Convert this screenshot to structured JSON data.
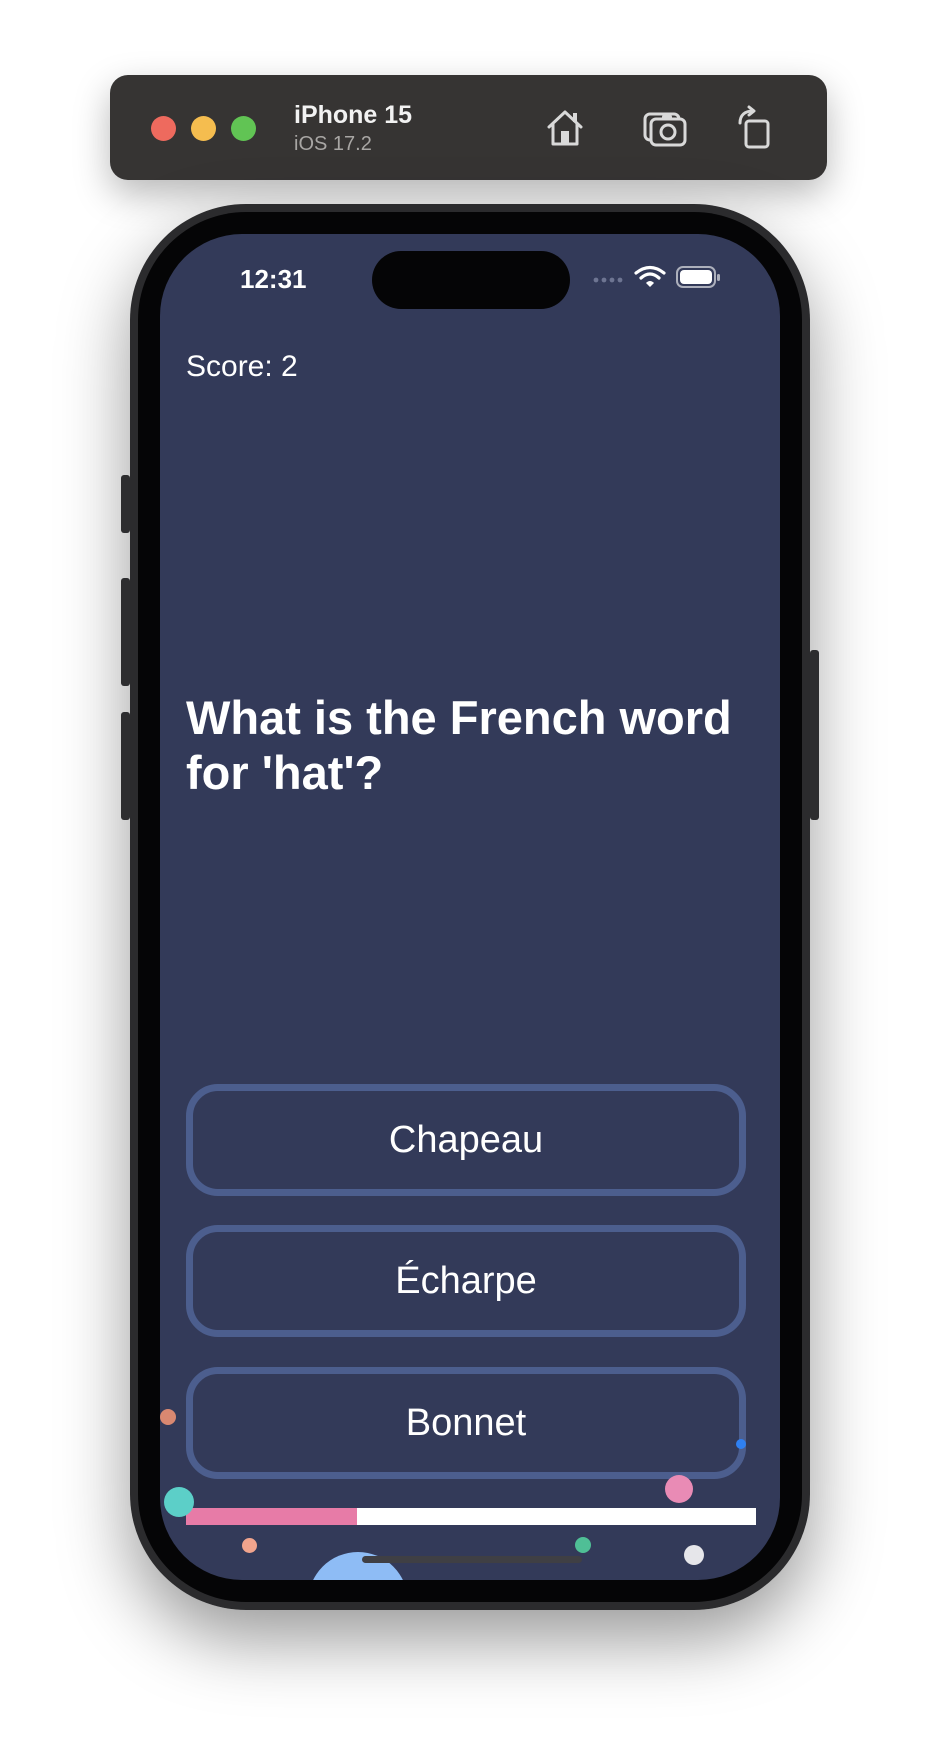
{
  "simulator": {
    "device_name": "iPhone 15",
    "os_version": "iOS 17.2",
    "toolbar_icons": [
      "home-icon",
      "screenshot-icon",
      "rotate-icon"
    ]
  },
  "status_bar": {
    "time": "12:31",
    "icons": [
      "signal-icon",
      "wifi-icon",
      "battery-icon"
    ]
  },
  "quiz": {
    "score_label": "Score: 2",
    "question": "What is the French word for 'hat'?",
    "answers": [
      "Chapeau",
      "Écharpe",
      "Bonnet"
    ],
    "progress": 0.3
  },
  "colors": {
    "background": "#333a59",
    "answer_border": "#4c5e8e",
    "progress_fill": "#e77ba7",
    "progress_track": "#ffffff",
    "confetti": [
      "#5ccfc8",
      "#f1a48d",
      "#e98bb5",
      "#4fbf96",
      "#2f80f2",
      "#e6e6ea",
      "#8ebcf5",
      "#d98871"
    ]
  }
}
